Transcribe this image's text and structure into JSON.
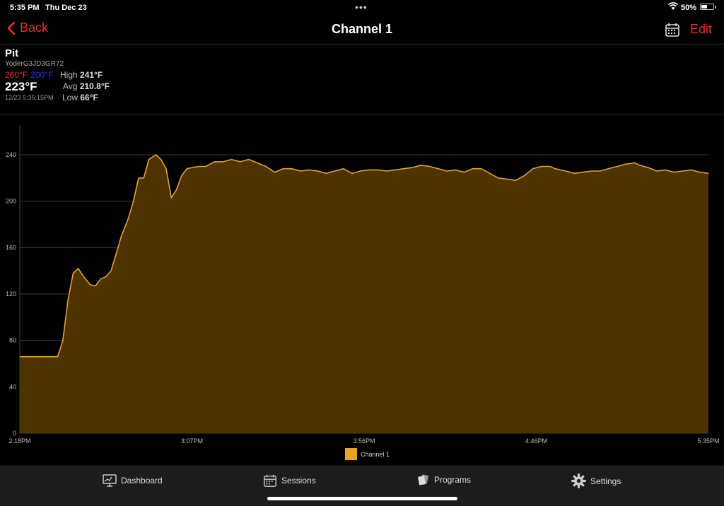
{
  "status_bar": {
    "time": "5:35 PM",
    "date": "Thu Dec 23",
    "battery": "50%",
    "battery_level": 0.5
  },
  "nav": {
    "back_label": "Back",
    "title": "Channel 1",
    "edit_label": "Edit",
    "calendar_icon": "calendar-icon"
  },
  "probe": {
    "name": "Pit",
    "device_id": "YoderG3JD3GR72",
    "high_alarm": "260°F",
    "low_alarm": "200°F",
    "current_temp": "223°F",
    "timestamp": "12/23 5:35:15PM",
    "high_label": "High",
    "high_value": "241°F",
    "avg_label": "Avg",
    "avg_value": "210.8°F",
    "low_label": "Low",
    "low_value": "66°F"
  },
  "colors": {
    "accent_red": "#e0322e",
    "low_alarm_blue": "#2a38d8",
    "series_line": "#e6a22b",
    "series_fill": "#4c3300"
  },
  "chart_data": {
    "type": "area",
    "x_ticks": [
      "2:18PM",
      "3:07PM",
      "3:56PM",
      "4:46PM",
      "5:35PM"
    ],
    "y_ticks": [
      0,
      40,
      80,
      120,
      160,
      200,
      240
    ],
    "ylim": [
      0,
      265
    ],
    "x_unit": "minutes since 2:18PM",
    "xlim": [
      0,
      197
    ],
    "grid": true,
    "legend_position": "bottom",
    "series": [
      {
        "name": "Channel 1",
        "points": [
          [
            0,
            66
          ],
          [
            22,
            66
          ],
          [
            25,
            80
          ],
          [
            28,
            115
          ],
          [
            31,
            138
          ],
          [
            34,
            142
          ],
          [
            37,
            135
          ],
          [
            41,
            128
          ],
          [
            44,
            127
          ],
          [
            47,
            133
          ],
          [
            50,
            135
          ],
          [
            53,
            140
          ],
          [
            56,
            155
          ],
          [
            59,
            170
          ],
          [
            63,
            185
          ],
          [
            66,
            200
          ],
          [
            69,
            220
          ],
          [
            72,
            220
          ],
          [
            75,
            236
          ],
          [
            79,
            240
          ],
          [
            82,
            236
          ],
          [
            85,
            228
          ],
          [
            88,
            203
          ],
          [
            91,
            210
          ],
          [
            94,
            222
          ],
          [
            97,
            228
          ],
          [
            100,
            229
          ],
          [
            104,
            230
          ],
          [
            108,
            230
          ],
          [
            113,
            234
          ],
          [
            118,
            234
          ],
          [
            123,
            236
          ],
          [
            128,
            234
          ],
          [
            133,
            236
          ],
          [
            138,
            233
          ],
          [
            143,
            230
          ],
          [
            148,
            225
          ],
          [
            153,
            228
          ],
          [
            158,
            228
          ],
          [
            163,
            226
          ],
          [
            168,
            227
          ],
          [
            173,
            226
          ],
          [
            178,
            224
          ],
          [
            183,
            226
          ],
          [
            188,
            228
          ],
          [
            193,
            224
          ],
          [
            198,
            226
          ],
          [
            203,
            227
          ],
          [
            208,
            227
          ],
          [
            213,
            226
          ],
          [
            218,
            227
          ],
          [
            223,
            228
          ],
          [
            228,
            229
          ],
          [
            233,
            231
          ],
          [
            238,
            230
          ],
          [
            243,
            228
          ],
          [
            248,
            226
          ],
          [
            253,
            227
          ],
          [
            258,
            225
          ],
          [
            263,
            228
          ],
          [
            268,
            228
          ],
          [
            273,
            224
          ],
          [
            278,
            220
          ],
          [
            283,
            219
          ],
          [
            288,
            218
          ],
          [
            293,
            222
          ],
          [
            298,
            228
          ],
          [
            303,
            230
          ],
          [
            308,
            230
          ],
          [
            311,
            228
          ],
          [
            317,
            226
          ],
          [
            322,
            224
          ],
          [
            327,
            225
          ],
          [
            332,
            226
          ],
          [
            337,
            226
          ],
          [
            342,
            228
          ],
          [
            347,
            230
          ],
          [
            352,
            232
          ],
          [
            357,
            233
          ],
          [
            360,
            231
          ],
          [
            365,
            229
          ],
          [
            370,
            226
          ],
          [
            375,
            227
          ],
          [
            380,
            225
          ],
          [
            385,
            226
          ],
          [
            390,
            227
          ],
          [
            395,
            225
          ],
          [
            400,
            224
          ]
        ]
      }
    ]
  },
  "tabs": [
    {
      "label": "Dashboard",
      "icon": "dashboard-icon"
    },
    {
      "label": "Sessions",
      "icon": "calendar-icon"
    },
    {
      "label": "Programs",
      "icon": "programs-icon"
    },
    {
      "label": "Settings",
      "icon": "gear-icon"
    }
  ]
}
